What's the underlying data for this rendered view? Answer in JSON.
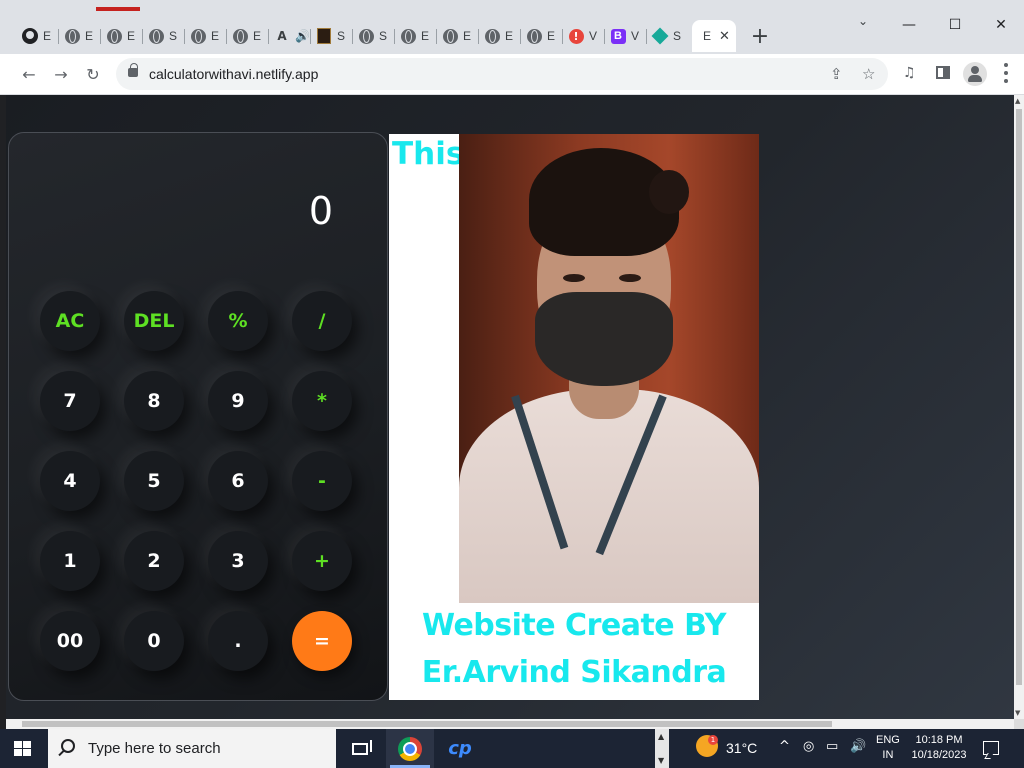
{
  "browser": {
    "tabs": [
      {
        "icon": "github-icon",
        "letter": "E"
      },
      {
        "icon": "globe-icon",
        "letter": "E"
      },
      {
        "icon": "globe-icon",
        "letter": "E"
      },
      {
        "icon": "globe-icon",
        "letter": "S"
      },
      {
        "icon": "globe-icon",
        "letter": "E"
      },
      {
        "icon": "globe-icon",
        "letter": "E"
      },
      {
        "icon": "letter-a-icon",
        "glyph": "A",
        "letter": "🔊"
      },
      {
        "icon": "video-thumb-icon",
        "letter": "S"
      },
      {
        "icon": "globe-icon",
        "letter": "S"
      },
      {
        "icon": "globe-icon",
        "letter": "E"
      },
      {
        "icon": "globe-icon",
        "letter": "E"
      },
      {
        "icon": "globe-icon",
        "letter": "E"
      },
      {
        "icon": "globe-icon",
        "letter": "E"
      },
      {
        "icon": "warning-icon",
        "glyph": "!",
        "letter": "V"
      },
      {
        "icon": "bootstrap-icon",
        "glyph": "B",
        "letter": "V"
      },
      {
        "icon": "diamond-icon",
        "letter": "S"
      }
    ],
    "active_tab": {
      "letter": "E",
      "close": "✕"
    },
    "new_tab": "+",
    "window_controls": {
      "tab_search": "⌄",
      "minimize": "—",
      "maximize": "☐",
      "close": "✕"
    },
    "toolbar": {
      "back": "←",
      "forward": "→",
      "reload": "↻",
      "url": "calculatorwithavi.netlify.app",
      "share": "⇪",
      "bookmark": "☆",
      "media": "♫"
    }
  },
  "calculator": {
    "display": "0",
    "keys": [
      {
        "label": "AC",
        "type": "op"
      },
      {
        "label": "DEL",
        "type": "op"
      },
      {
        "label": "%",
        "type": "op"
      },
      {
        "label": "/",
        "type": "op"
      },
      {
        "label": "7",
        "type": "num"
      },
      {
        "label": "8",
        "type": "num"
      },
      {
        "label": "9",
        "type": "num"
      },
      {
        "label": "*",
        "type": "op"
      },
      {
        "label": "4",
        "type": "num"
      },
      {
        "label": "5",
        "type": "num"
      },
      {
        "label": "6",
        "type": "num"
      },
      {
        "label": "-",
        "type": "op"
      },
      {
        "label": "1",
        "type": "num"
      },
      {
        "label": "2",
        "type": "num"
      },
      {
        "label": "3",
        "type": "num"
      },
      {
        "label": "+",
        "type": "op"
      },
      {
        "label": "00",
        "type": "num"
      },
      {
        "label": "0",
        "type": "num"
      },
      {
        "label": ".",
        "type": "num"
      },
      {
        "label": "=",
        "type": "eq"
      }
    ],
    "colors": {
      "operator": "#5ee023",
      "equals": "#ff7a17",
      "number": "#ffffff"
    }
  },
  "credits": {
    "line_this": "This",
    "line1": "Website Create BY",
    "line2": "Er.Arvind Sikandra",
    "color": "#18e8ed"
  },
  "taskbar": {
    "search_placeholder": "Type here to search",
    "temperature": "31°C",
    "tray_chevron": "^",
    "language": "ENG",
    "region": "IN",
    "time": "10:18 PM",
    "date": "10/18/2023"
  }
}
